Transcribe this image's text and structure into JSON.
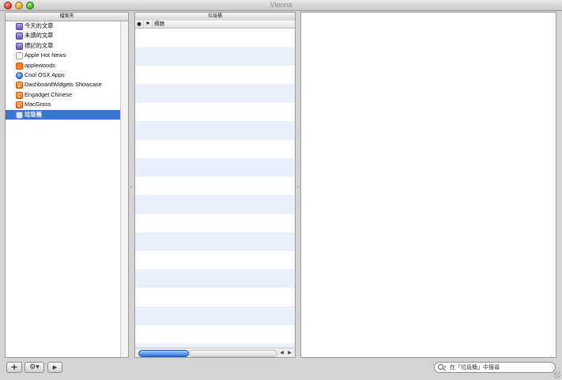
{
  "window": {
    "title": "Vienna"
  },
  "folders": {
    "header": "檔案夾",
    "items": [
      {
        "label": "今天的文章",
        "icon": "smart-folder-icon"
      },
      {
        "label": "未讀的文章",
        "icon": "smart-folder-icon"
      },
      {
        "label": "標記的文章",
        "icon": "smart-folder-icon"
      },
      {
        "label": "Apple Hot News",
        "icon": "apple-feed-icon"
      },
      {
        "label": "applewoods",
        "icon": "blogger-feed-icon"
      },
      {
        "label": "Cool OSX Apps",
        "icon": "globe-feed-icon"
      },
      {
        "label": "DashboardWidgets Showcase",
        "icon": "rss-feed-icon"
      },
      {
        "label": "Engadget Chinese",
        "icon": "rss-feed-icon"
      },
      {
        "label": "MacGrass",
        "icon": "rss-feed-icon"
      },
      {
        "label": "垃圾桶",
        "icon": "trash-icon",
        "selected": true
      }
    ]
  },
  "articles": {
    "header": "垃圾桶",
    "columns": {
      "unread": "●",
      "flag": "⚑",
      "title": "標題"
    }
  },
  "toolbar": {
    "add_label": "+",
    "action_label": "⚙▾",
    "play_label": "▶"
  },
  "search": {
    "placeholder": "在「垃圾桶」中搜尋"
  }
}
